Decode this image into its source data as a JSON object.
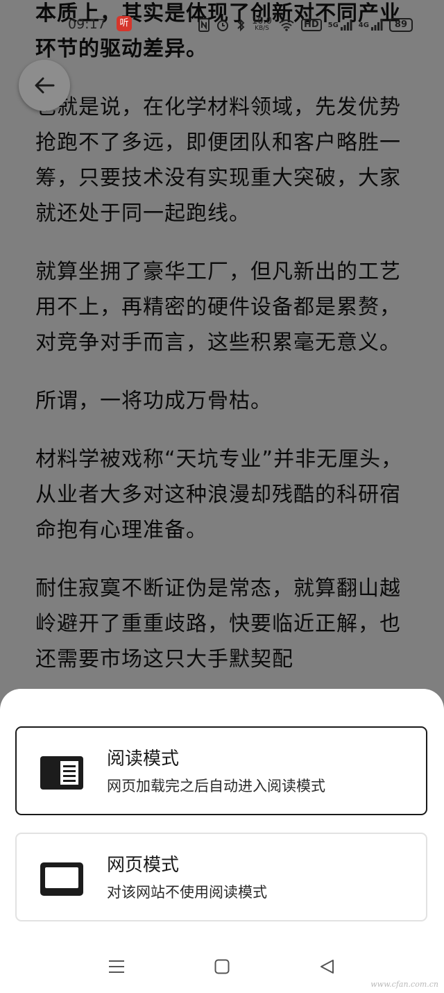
{
  "status_bar": {
    "time": "09:17",
    "app_badge": "听",
    "net_speed_value": "10.0",
    "net_speed_unit": "KB/S",
    "hd": "HD",
    "signal_1": "5G",
    "signal_2": "4G",
    "battery": "89"
  },
  "article": {
    "paragraphs": [
      "本质上，其实是体现了创新对不同产业环节的驱动差异。",
      "也就是说，在化学材料领域，先发优势抢跑不了多远，即便团队和客户略胜一筹，只要技术没有实现重大突破，大家就还处于同一起跑线。",
      "就算坐拥了豪华工厂，但凡新出的工艺用不上，再精密的硬件设备都是累赘，对竞争对手而言，这些积累毫无意义。",
      "所谓，一将功成万骨枯。",
      "材料学被戏称“天坑专业”并非无厘头，从业者大多对这种浪漫却残酷的科研宿命抱有心理准备。",
      "耐住寂寞不断证伪是常态，就算翻山越岭避开了重重歧路，快要临近正解，也还需要市场这只大手默契配"
    ]
  },
  "sheet": {
    "options": [
      {
        "title": "阅读模式",
        "subtitle": "网页加载完之后自动进入阅读模式",
        "icon": "reader-mode-icon",
        "selected": true
      },
      {
        "title": "网页模式",
        "subtitle": "对该网站不使用阅读模式",
        "icon": "webpage-mode-icon",
        "selected": false
      }
    ]
  },
  "navbar": {
    "icons": [
      "menu-icon",
      "home-square-icon",
      "back-triangle-icon"
    ]
  },
  "watermark": "www.cfan.com.cn",
  "colors": {
    "overlay": "#7a7a7a",
    "sheet_bg": "#ffffff",
    "selected_border": "#1a1a1a",
    "normal_border": "#e2e2e2"
  }
}
